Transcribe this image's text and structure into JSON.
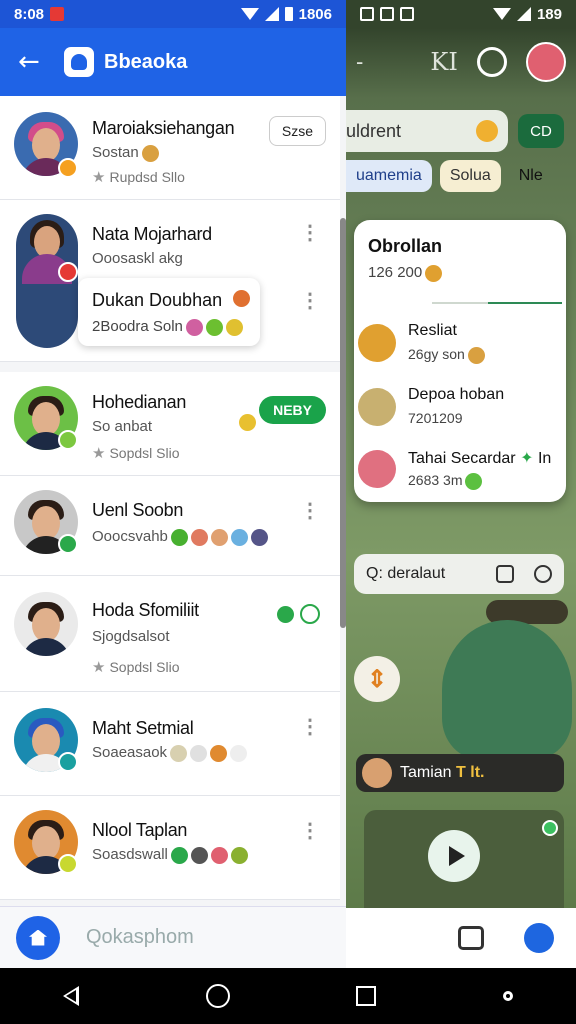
{
  "status_bar": {
    "time_left": "8:08",
    "time_right": "1806",
    "time_far_right": "189"
  },
  "drawer": {
    "title": "Bbeaoka",
    "chats": [
      {
        "name": "Maroiaksiehangan",
        "sub": "Sostan",
        "meta": "Rupdsd Sllo",
        "action": "Szse"
      },
      {
        "name": "Nata Mojarhard",
        "sub": "Ooosaskl akg"
      },
      {
        "name": "Dukan Doubhan",
        "sub": "2Boodra Soln"
      },
      {
        "name": "Hohedianan",
        "sub": "So anbat",
        "meta": "Sopdsl Slio",
        "action": "NEBY"
      },
      {
        "name": "Uenl Soobn",
        "sub": "Ooocsvahb"
      },
      {
        "name": "Hoda Sfomiliit",
        "sub": "Sjogdsalsot",
        "meta": "Sopdsl Slio"
      },
      {
        "name": "Maht Setmial",
        "sub": "Soaeasaok"
      },
      {
        "name": "Nlool Taplan",
        "sub": "Soasdswall"
      }
    ],
    "search_placeholder": "Qokasphom"
  },
  "right_pane": {
    "header_label": "KI",
    "search_text": "uldrent",
    "green_button": "CD",
    "chips": [
      "uamemia",
      "Solua",
      "Nle"
    ],
    "popup": {
      "title": "Obrollan",
      "count": "126 200",
      "rows": [
        {
          "name": "Resliat",
          "sub": "26gy son"
        },
        {
          "name": "Depoa hoban",
          "sub": "7201209"
        },
        {
          "name": "Tahai Secardar",
          "extra": "In",
          "sub": "2683 3m"
        }
      ]
    },
    "search2": "Q: deralaut",
    "banner": "Tamian",
    "banner_extra": "T lt."
  }
}
